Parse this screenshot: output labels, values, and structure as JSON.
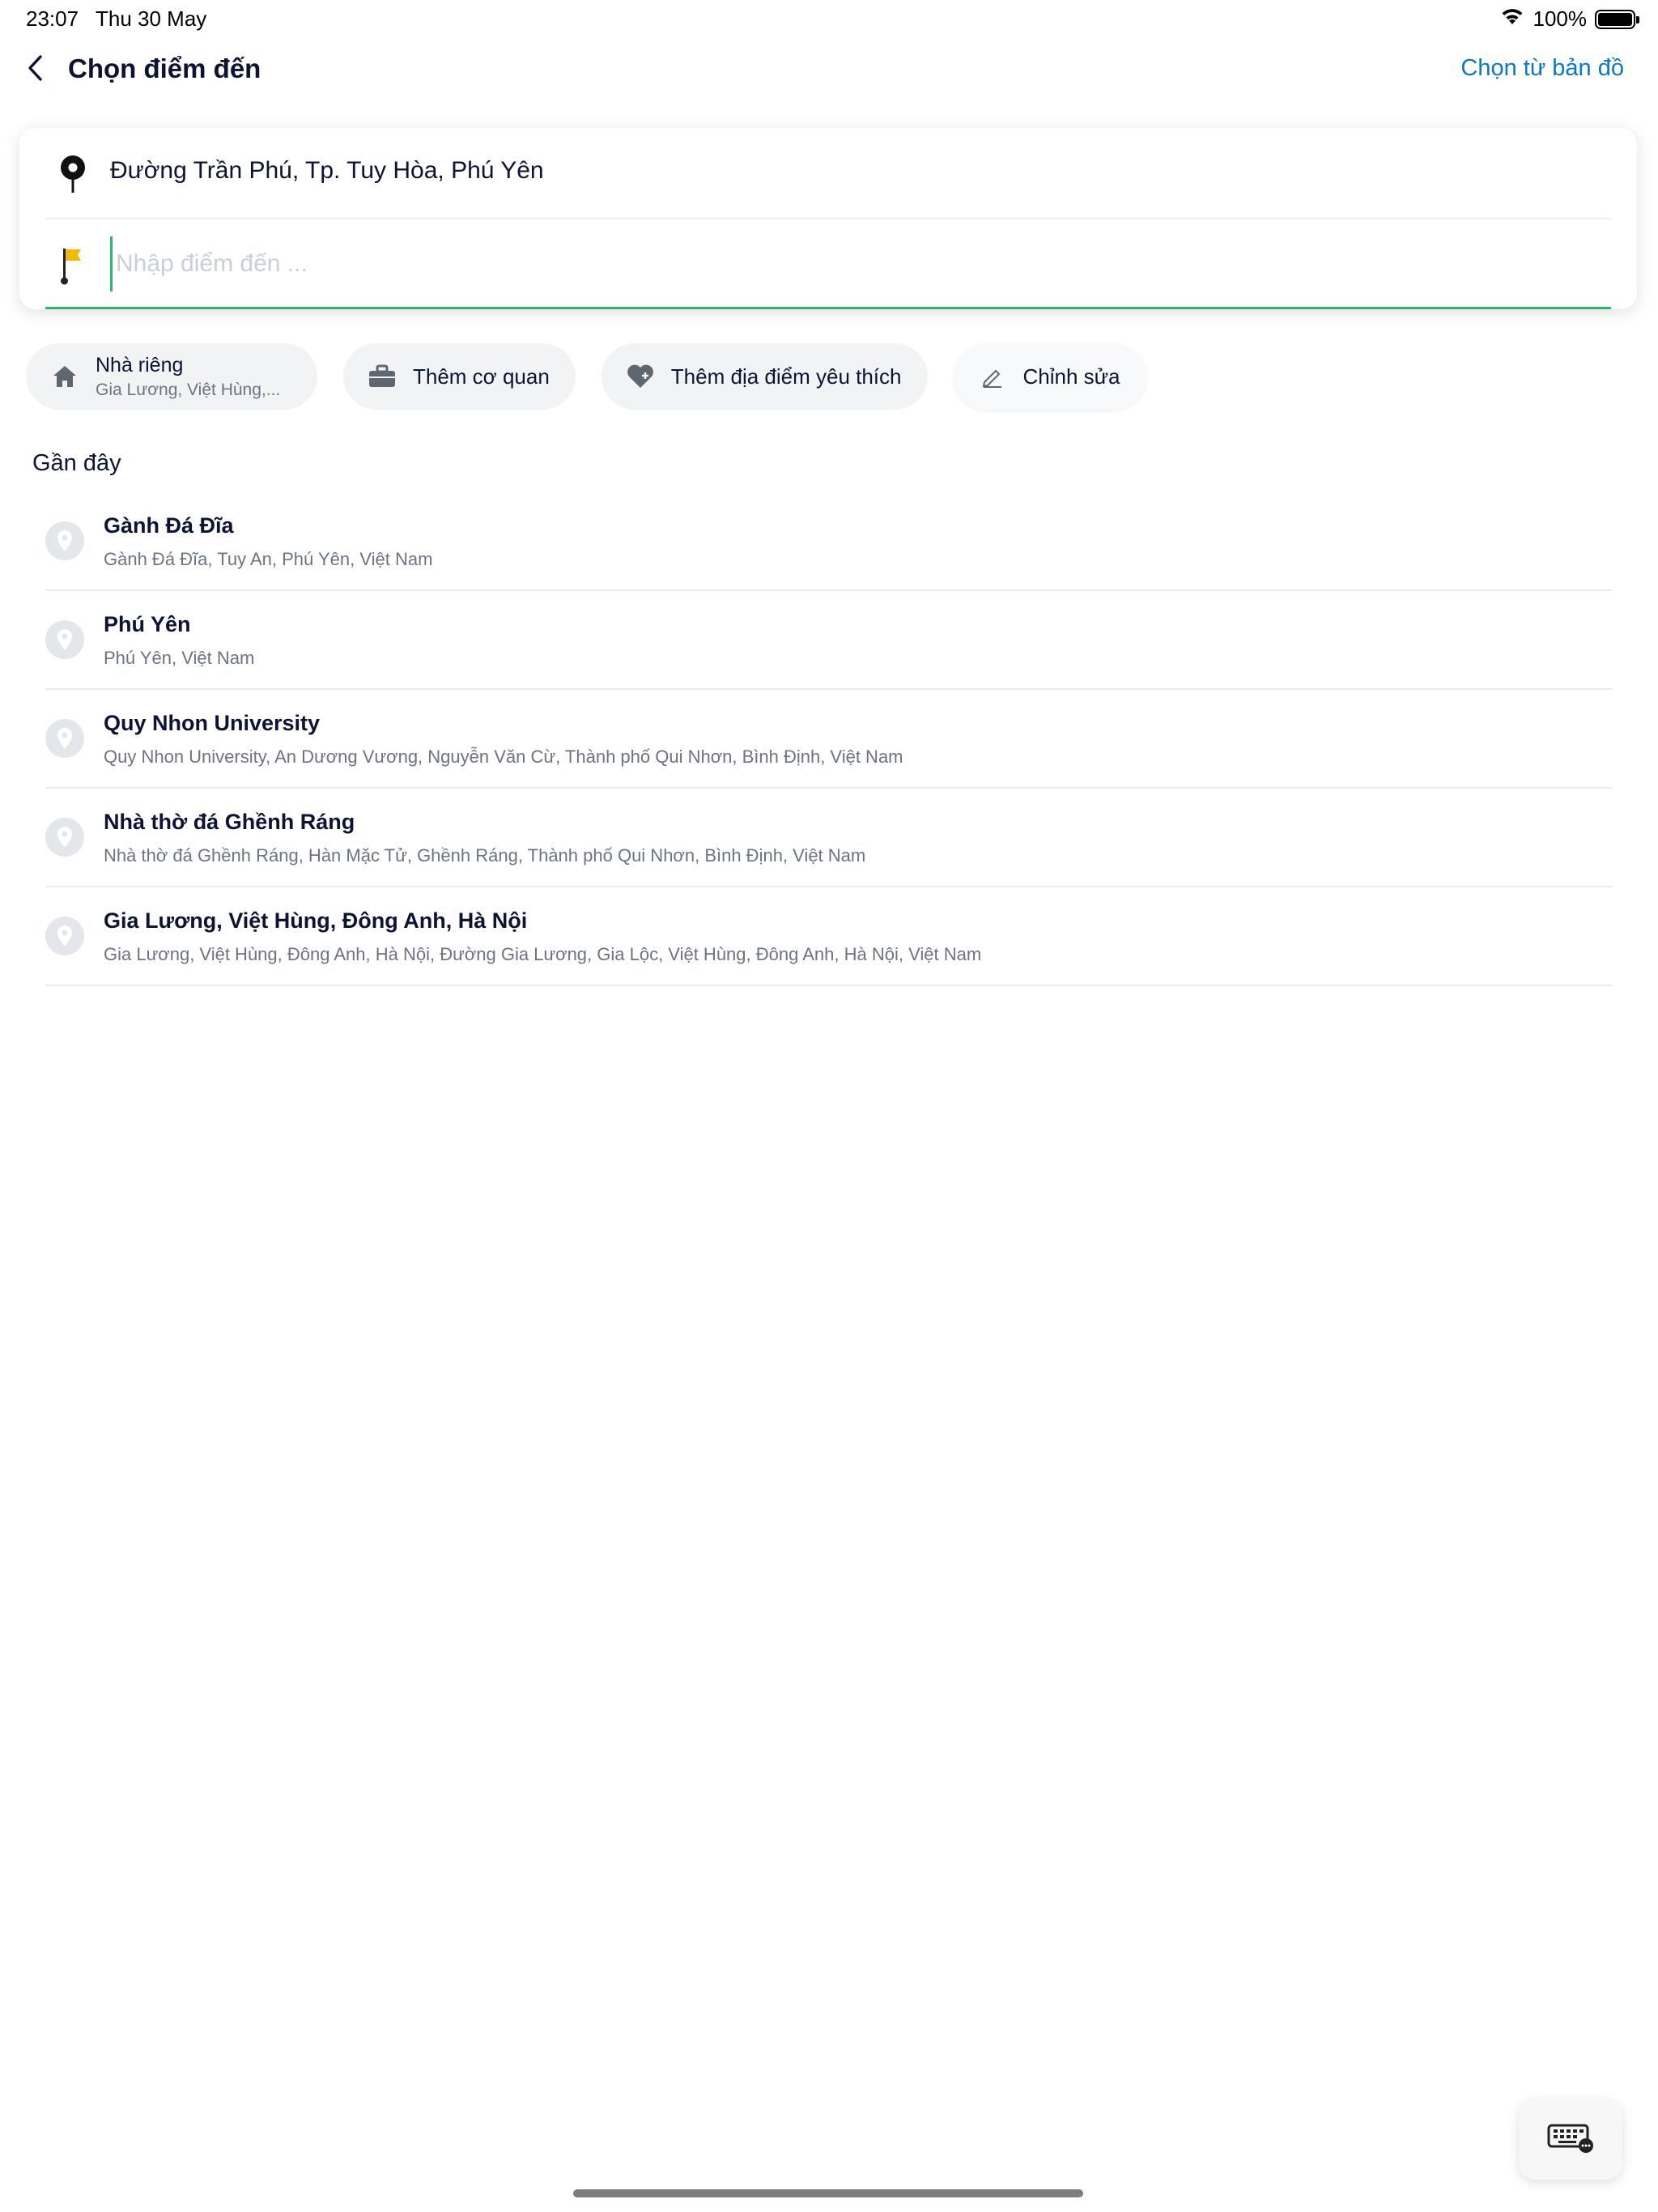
{
  "status_bar": {
    "time": "23:07",
    "date": "Thu 30 May",
    "battery": "100%",
    "battery_level": 1.0
  },
  "header": {
    "title": "Chọn điểm đến",
    "map_link": "Chọn từ bản đồ"
  },
  "route": {
    "origin": "Đường Trần Phú, Tp. Tuy Hòa, Phú Yên",
    "destination_placeholder": "Nhập điểm đến ...",
    "destination_value": ""
  },
  "chips": {
    "home": {
      "label": "Nhà riêng",
      "sub": "Gia Lương, Việt Hùng,..."
    },
    "work": {
      "label": "Thêm cơ quan"
    },
    "favorite": {
      "label": "Thêm địa điểm yêu thích"
    },
    "edit": {
      "label": "Chỉnh sửa"
    }
  },
  "recent": {
    "title": "Gần đây",
    "items": [
      {
        "title": "Gành Đá Đĩa",
        "subtitle": "Gành Đá Đĩa, Tuy An, Phú Yên, Việt Nam"
      },
      {
        "title": "Phú Yên",
        "subtitle": "Phú Yên, Việt Nam"
      },
      {
        "title": "Quy Nhon University",
        "subtitle": "Quy Nhon University, An Dương Vương, Nguyễn Văn Cừ, Thành phố Qui Nhơn, Bình Định, Việt Nam"
      },
      {
        "title": "Nhà thờ đá Ghềnh Ráng",
        "subtitle": "Nhà thờ đá Ghềnh Ráng, Hàn Mặc Tử, Ghềnh Ráng, Thành phố Qui Nhơn, Bình Định, Việt Nam"
      },
      {
        "title": "Gia Lương, Việt Hùng, Đông Anh, Hà Nội",
        "subtitle": "Gia Lương, Việt Hùng, Đông Anh, Hà Nội, Đường Gia Lương, Gia Lộc, Việt Hùng, Đông Anh, Hà Nội, Việt Nam"
      }
    ]
  },
  "icons": {
    "back": "chevron-left-icon",
    "origin": "map-pin-icon",
    "destination": "flag-icon",
    "home": "house-icon",
    "work": "briefcase-icon",
    "favorite": "heart-icon",
    "edit": "pencil-icon",
    "recent_item": "location-pin-icon",
    "keyboard": "keyboard-icon"
  },
  "colors": {
    "accent": "#0b77c6",
    "focus": "#2eb86b",
    "flag": "#f5b800",
    "text": "#0b1433",
    "muted": "#6b7480"
  }
}
